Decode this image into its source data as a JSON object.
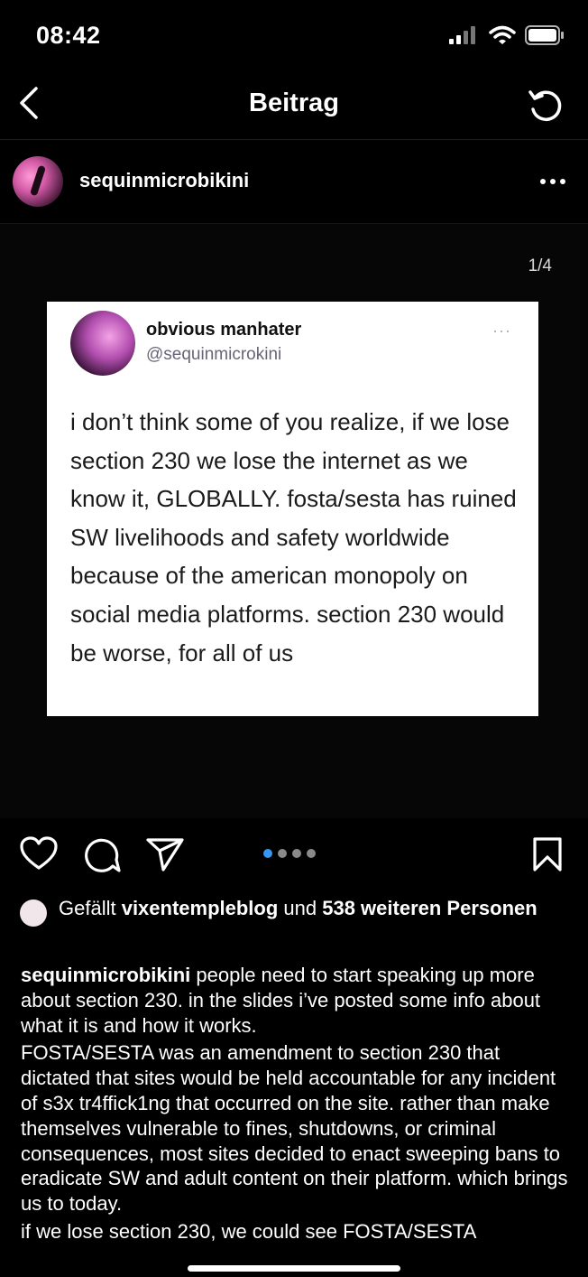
{
  "status": {
    "time": "08:42"
  },
  "nav": {
    "title": "Beitrag"
  },
  "post": {
    "username": "sequinmicrobikini",
    "slide_counter": "1/4",
    "tweet": {
      "name": "obvious manhater",
      "handle": "@sequinmicrokini",
      "more": "···",
      "text": "i don’t think some of you realize, if we lose section 230 we lose the internet as we know it, GLOBALLY. fosta/sesta has ruined SW livelihoods and safety worldwide because of the american monopoly on social media platforms. section 230 would be worse, for all of us"
    },
    "likes": {
      "prefix": "Gefällt ",
      "user": "vixentempleblog",
      "middle": " und ",
      "count": "538 weiteren",
      "suffix": " Personen"
    },
    "caption": {
      "user": "sequinmicrobikini",
      "p1": " people need to start speaking up more about section 230. in the slides i’ve posted some info about what it is and how it works.",
      "p2": "FOSTA/SESTA was an amendment to section 230 that dictated that sites would be held accountable for any incident of s3x tr4ffick1ng that occurred on the site. rather than make themselves vulnerable to fines, shutdowns, or criminal consequences, most sites decided to enact sweeping bans to eradicate SW and adult content on their platform. which brings us to today.",
      "p3": "if we lose section 230, we could see FOSTA/SESTA"
    }
  },
  "icons": {
    "signal": "signal-icon",
    "wifi": "wifi-icon",
    "battery": "battery-icon",
    "back": "chevron-left-icon",
    "refresh": "refresh-icon",
    "more": "more-horizontal-icon",
    "like": "heart-icon",
    "comment": "comment-icon",
    "share": "paper-plane-icon",
    "save": "bookmark-icon"
  },
  "carousel": {
    "count": 4,
    "active": 1
  },
  "colors": {
    "background": "#000000",
    "accent": "#3897f0"
  }
}
